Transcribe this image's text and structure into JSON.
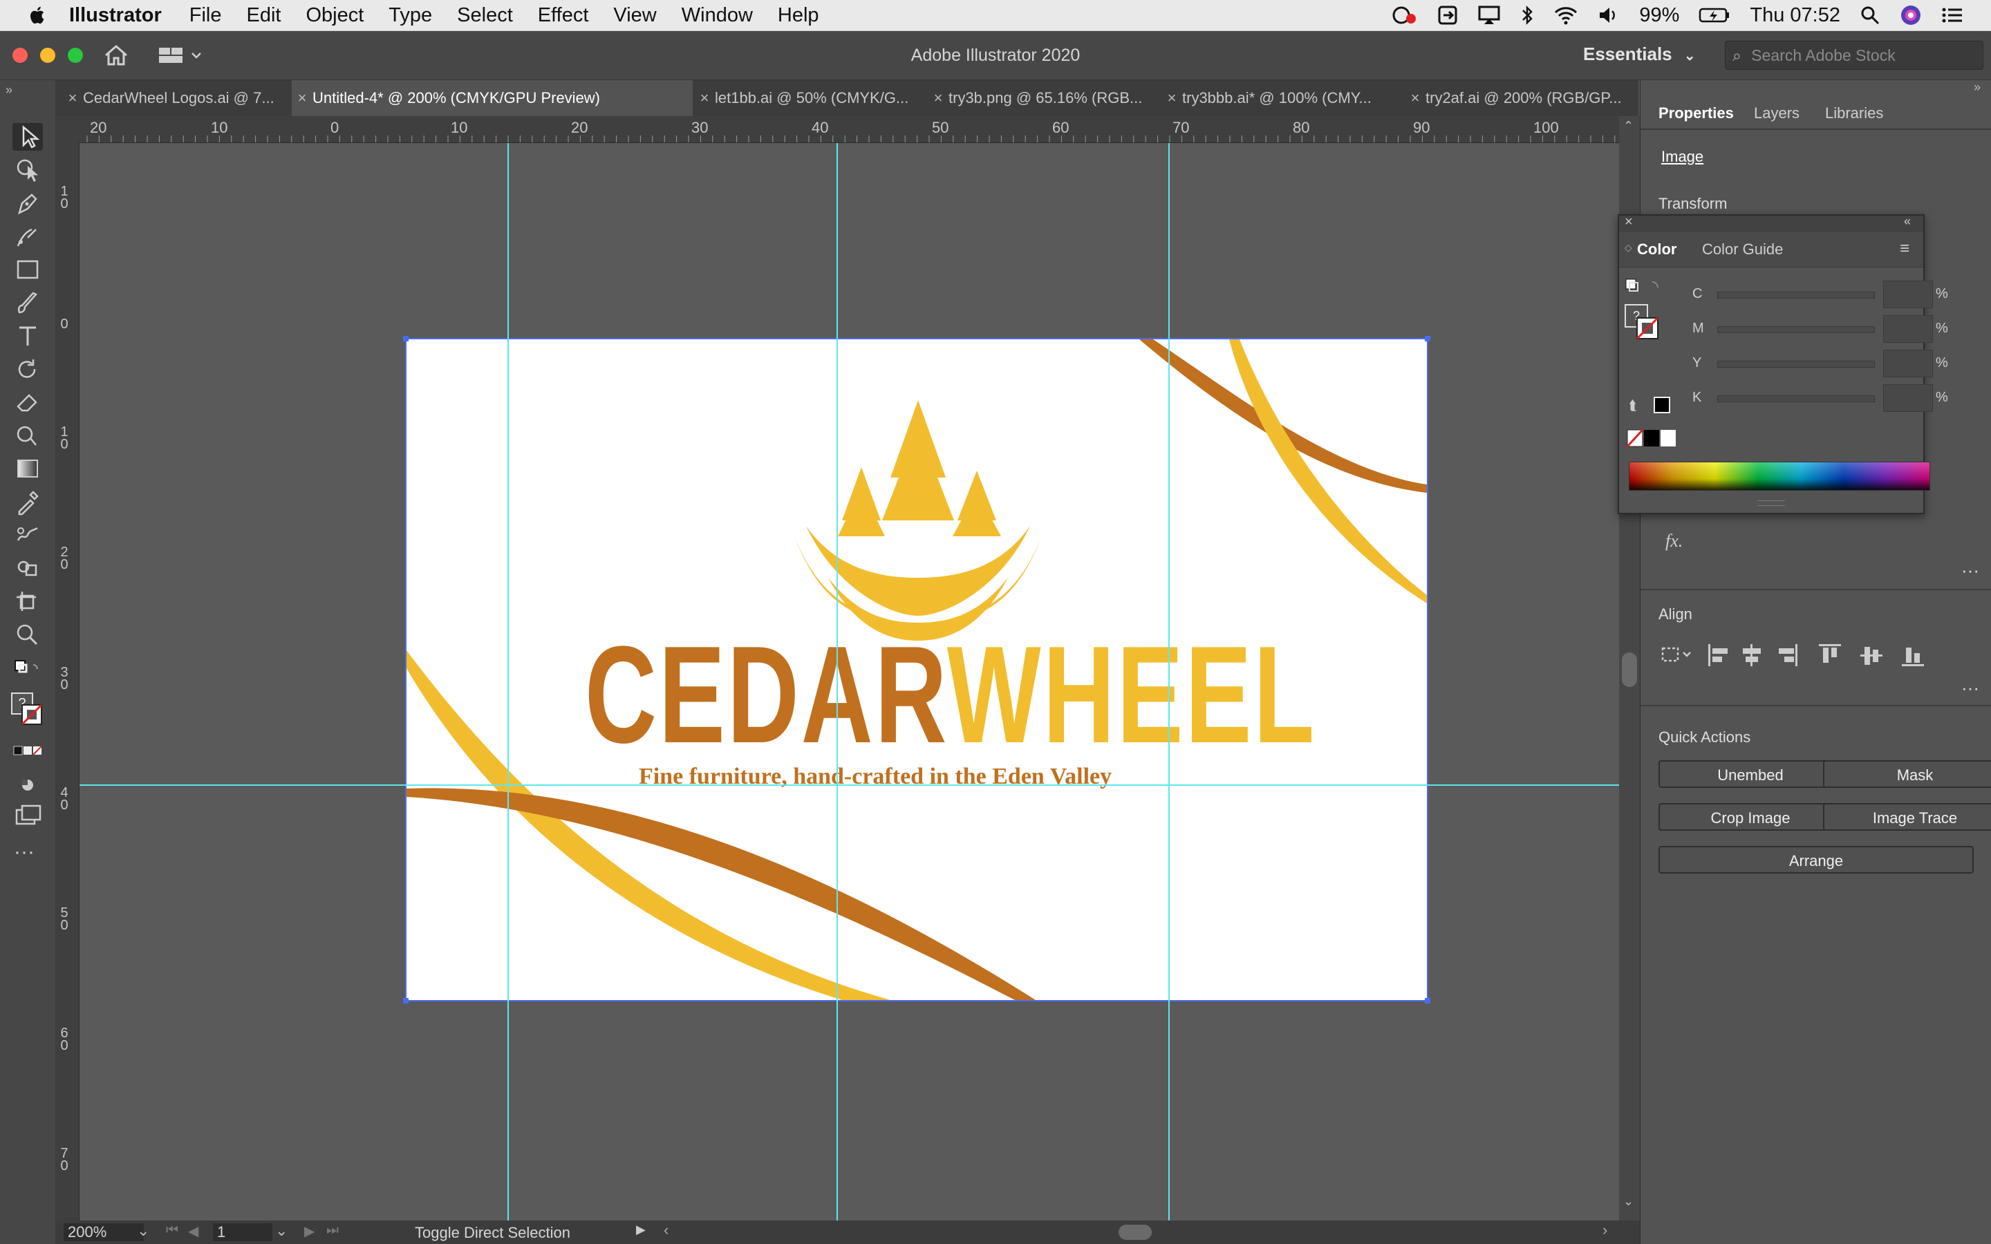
{
  "menubar": {
    "app_name": "Illustrator",
    "items": [
      "File",
      "Edit",
      "Object",
      "Type",
      "Select",
      "Effect",
      "View",
      "Window",
      "Help"
    ],
    "battery": "99%",
    "clock": "Thu 07:52"
  },
  "titlebar": {
    "title": "Adobe Illustrator 2020",
    "workspace": "Essentials",
    "search_placeholder": "Search Adobe Stock"
  },
  "tabs": [
    {
      "label": "CedarWheel Logos.ai @ 7...",
      "active": false
    },
    {
      "label": "Untitled-4* @ 200% (CMYK/GPU Preview)",
      "active": true
    },
    {
      "label": "let1bb.ai @ 50% (CMYK/G...",
      "active": false
    },
    {
      "label": "try3b.png @ 65.16% (RGB...",
      "active": false
    },
    {
      "label": "try3bbb.ai* @ 100% (CMY...",
      "active": false
    },
    {
      "label": "try2af.ai @ 200% (RGB/GP...",
      "active": false
    }
  ],
  "ruler": {
    "h_labels": [
      "20",
      "10",
      "0",
      "10",
      "20",
      "30",
      "40",
      "50",
      "60",
      "70",
      "80",
      "90",
      "100"
    ],
    "v_labels": [
      "1 0",
      "0",
      "1 0",
      "2 0",
      "3 0",
      "4 0",
      "5 0",
      "6 0",
      "7 0"
    ]
  },
  "artwork": {
    "word_dark": "CEDAR",
    "word_light": "WHEEL",
    "tagline": "Fine furniture, hand-crafted in the Eden Valley",
    "color_dark": "#c0701f",
    "color_light": "#f1bd2f"
  },
  "panel": {
    "tabs": [
      "Properties",
      "Layers",
      "Libraries"
    ],
    "selection_type": "Image",
    "transform_label": "Transform",
    "fx_label": "fx.",
    "align_label": "Align",
    "quick_actions_label": "Quick Actions",
    "buttons": [
      "Unembed",
      "Mask",
      "Crop Image",
      "Image Trace",
      "Arrange"
    ]
  },
  "color_panel": {
    "tabs": [
      "Color",
      "Color Guide"
    ],
    "channels": [
      "C",
      "M",
      "Y",
      "K"
    ],
    "unit": "%"
  },
  "status": {
    "zoom": "200%",
    "artboard_number": "1",
    "message": "Toggle Direct Selection"
  }
}
